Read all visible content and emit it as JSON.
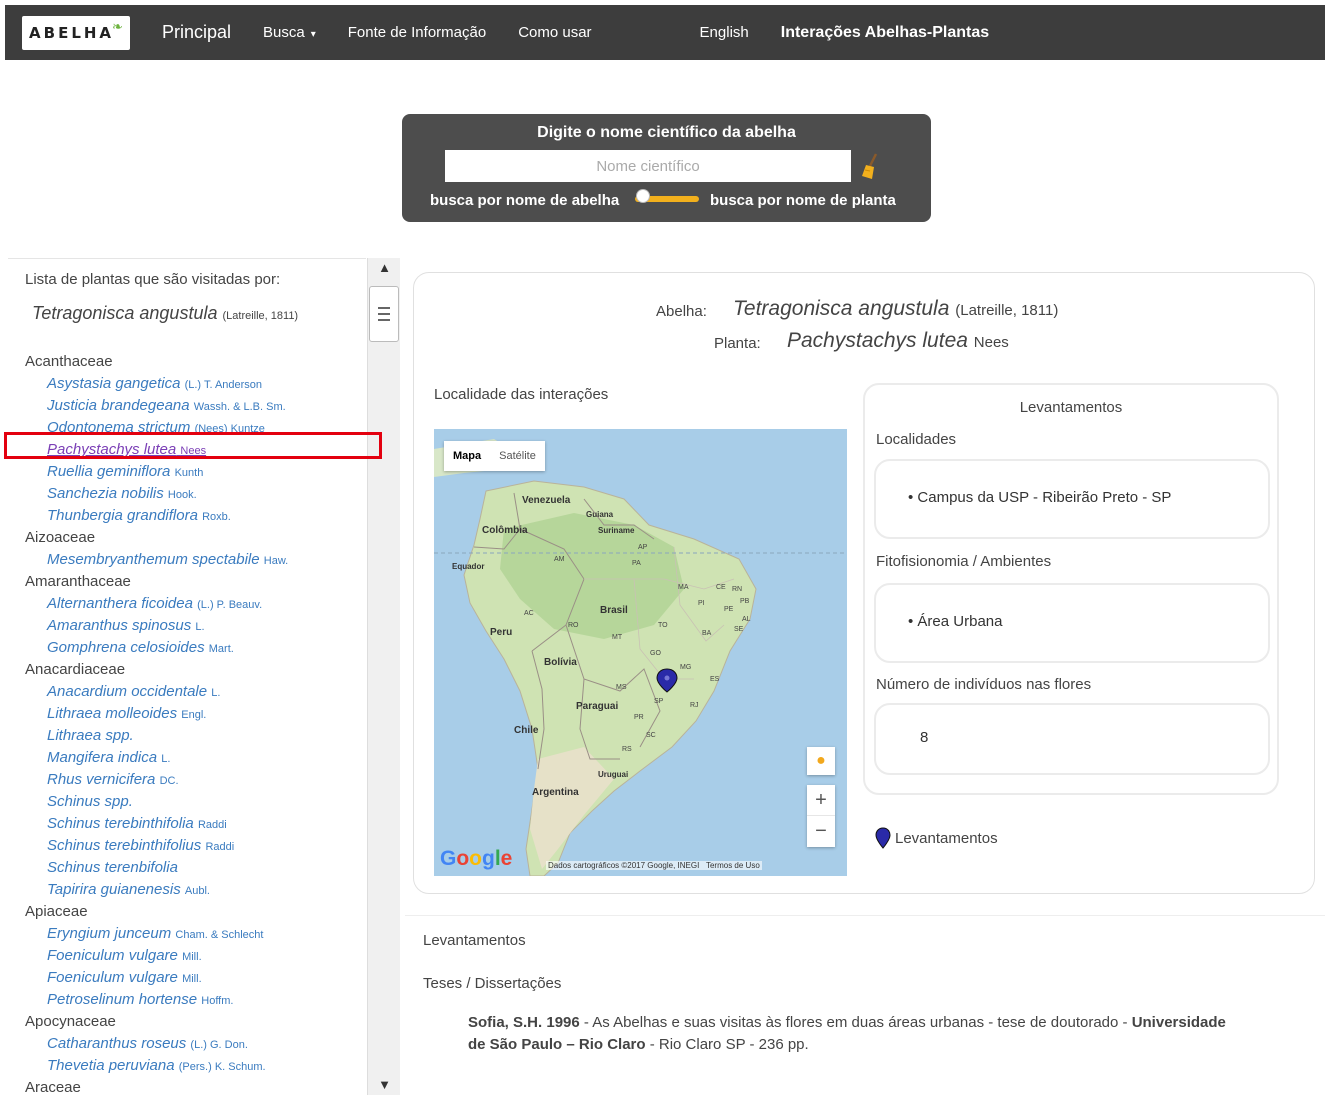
{
  "nav": {
    "logo": "ABELHA",
    "items": [
      {
        "label": "Principal",
        "name": "nav-principal"
      },
      {
        "label": "Busca",
        "name": "nav-busca",
        "caret": "▾"
      },
      {
        "label": "Fonte de Informação",
        "name": "nav-fonte"
      },
      {
        "label": "Como usar",
        "name": "nav-como-usar"
      },
      {
        "label": "English",
        "name": "nav-english"
      },
      {
        "label": "Interações Abelhas-Plantas",
        "name": "nav-interacoes"
      }
    ]
  },
  "search": {
    "title": "Digite o nome científico da abelha",
    "placeholder": "Nome científico",
    "toggle_left": "busca por nome de abelha",
    "toggle_right": "busca por nome de planta",
    "accent": "#f2b01d"
  },
  "list": {
    "header": "Lista de plantas que são visitadas por:",
    "bee": {
      "name": "Tetragonisca angustula",
      "author": "(Latreille, 1811)"
    },
    "groups": [
      {
        "family": "Acanthaceae",
        "plants": [
          {
            "name": "Asystasia gangetica",
            "author": "(L.) T. Anderson"
          },
          {
            "name": "Justicia brandegeana",
            "author": "Wassh. & L.B. Sm."
          },
          {
            "name": "Odontonema strictum",
            "author": "(Nees) Kuntze"
          },
          {
            "name": "Pachystachys lutea",
            "author": "Nees",
            "selected": true
          },
          {
            "name": "Ruellia geminiflora",
            "author": "Kunth"
          },
          {
            "name": "Sanchezia nobilis",
            "author": "Hook."
          },
          {
            "name": "Thunbergia grandiflora",
            "author": "Roxb."
          }
        ]
      },
      {
        "family": "Aizoaceae",
        "plants": [
          {
            "name": "Mesembryanthemum spectabile",
            "author": "Haw."
          }
        ]
      },
      {
        "family": "Amaranthaceae",
        "plants": [
          {
            "name": "Alternanthera ficoidea",
            "author": "(L.) P. Beauv."
          },
          {
            "name": "Amaranthus spinosus",
            "author": "L."
          },
          {
            "name": "Gomphrena celosioides",
            "author": "Mart."
          }
        ]
      },
      {
        "family": "Anacardiaceae",
        "plants": [
          {
            "name": "Anacardium occidentale",
            "author": "L."
          },
          {
            "name": "Lithraea molleoides",
            "author": "Engl."
          },
          {
            "name": "Lithraea spp.",
            "author": ""
          },
          {
            "name": "Mangifera indica",
            "author": "L."
          },
          {
            "name": "Rhus vernicifera",
            "author": "DC."
          },
          {
            "name": "Schinus spp.",
            "author": ""
          },
          {
            "name": "Schinus terebinthifolia",
            "author": "Raddi"
          },
          {
            "name": "Schinus terebinthifolius",
            "author": "Raddi"
          },
          {
            "name": "Schinus terenbifolia",
            "author": ""
          },
          {
            "name": "Tapirira guianenesis",
            "author": "Aubl."
          }
        ]
      },
      {
        "family": "Apiaceae",
        "plants": [
          {
            "name": "Eryngium junceum",
            "author": "Cham. & Schlecht"
          },
          {
            "name": "Foeniculum vulgare",
            "author": "Mill."
          },
          {
            "name": "Foeniculum vulgare",
            "author": "Mill."
          },
          {
            "name": "Petroselinum hortense",
            "author": "Hoffm."
          }
        ]
      },
      {
        "family": "Apocynaceae",
        "plants": [
          {
            "name": "Catharanthus roseus",
            "author": "(L.) G. Don."
          },
          {
            "name": "Thevetia peruviana",
            "author": "(Pers.) K. Schum."
          }
        ]
      },
      {
        "family": "Araceae",
        "plants": []
      }
    ]
  },
  "detail": {
    "abelha_label": "Abelha:",
    "abelha_name": "Tetragonisca angustula",
    "abelha_author": "(Latreille, 1811)",
    "planta_label": "Planta:",
    "planta_name": "Pachystachys lutea",
    "planta_author": "Nees",
    "local_label": "Localidade das interações",
    "map": {
      "tab_map": "Mapa",
      "tab_sat": "Satélite",
      "zoom_in": "+",
      "zoom_out": "−",
      "google": "Google",
      "attribution": "Dados cartográficos ©2017 Google, INEGI",
      "terms": "Termos de Uso",
      "labels": [
        "Venezuela",
        "Guiana",
        "Suriname",
        "Colômbia",
        "Equador",
        "Brasil",
        "Peru",
        "Bolívia",
        "Paraguai",
        "Chile",
        "Argentina",
        "Uruguai",
        "AP",
        "AM",
        "PA",
        "MA",
        "CE",
        "RN",
        "PB",
        "PE",
        "PI",
        "AL",
        "SE",
        "TO",
        "BA",
        "AC",
        "RO",
        "MT",
        "GO",
        "MG",
        "ES",
        "MS",
        "SP",
        "RJ",
        "PR",
        "SC",
        "RS"
      ]
    },
    "levantamentos": {
      "title": "Levantamentos",
      "localidades_label": "Localidades",
      "localidades_value": "• Campus da USP - Ribeirão Preto - SP",
      "fito_label": "Fitofisionomia / Ambientes",
      "fito_value": "• Área Urbana",
      "num_label": "Número de indivíduos nas flores",
      "num_value": "8"
    },
    "legend": "Levantamentos"
  },
  "bottom": {
    "title": "Levantamentos",
    "teses": "Teses / Dissertações",
    "ref_bold1": "Sofia, S.H. 1996",
    "ref_text1": " - As Abelhas e suas visitas às flores em duas áreas urbanas - tese de doutorado - ",
    "ref_bold2": "Universidade de São Paulo – Rio Claro",
    "ref_text2": " - Rio Claro SP - 236 pp."
  }
}
